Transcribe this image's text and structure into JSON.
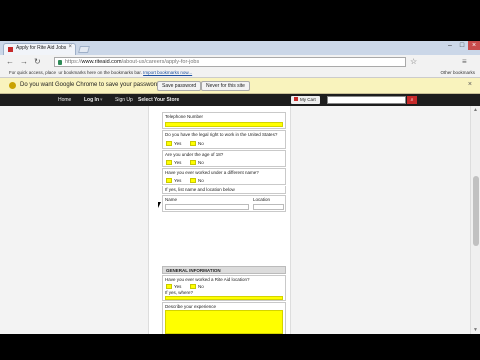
{
  "tab": {
    "title": "Apply for Rite Aid Jobs",
    "close": "×"
  },
  "window": {
    "minimize": "–",
    "maximize": "□",
    "close": "×"
  },
  "nav_icons": {
    "back": "←",
    "forward": "→",
    "reload": "↻"
  },
  "omnibox": {
    "scheme": "https://",
    "host": "www.riteaid.com",
    "path": "/about-us/careers/apply-for-jobs"
  },
  "toolbar_icons": {
    "star": "☆",
    "menu": "≡"
  },
  "bookmarks": {
    "prefix": "For quick access, place",
    "middle": "ur bookmarks here on the bookmarks bar.",
    "link": "Import bookmarks now...",
    "other": "Other bookmarks"
  },
  "infobar": {
    "question": "Do you want Google Chrome to save your password?",
    "save": "Save password",
    "never": "Never for this site",
    "close": "×"
  },
  "sitenav": {
    "home": "Home",
    "login": "Log In",
    "signup": "Sign Up",
    "store": "Select Your Store",
    "cart": "My Cart",
    "search_placeholder": "Search"
  },
  "form": {
    "telephone_label": "Telephone Number",
    "legal_q": "Do you have the legal right to work in the United States?",
    "age_q": "Are you under the age of 18?",
    "alias_q": "Have you ever worked under a different name?",
    "alias_hint": "If yes, list name and location below",
    "name_col": "Name",
    "location_col": "Location",
    "yes": "Yes",
    "no": "No",
    "section_title": "GENERAL INFORMATION",
    "employed_q": "Have you ever worked a Rite Aid location?",
    "where_hint": "If yes, where?",
    "experience_q": "Describe your experience"
  },
  "scroll": {
    "up": "▲",
    "down": "▼"
  },
  "colors": {
    "required_field": "#ffff00",
    "nav_bg": "#1d1d1d",
    "search_button": "#c62a2a"
  }
}
